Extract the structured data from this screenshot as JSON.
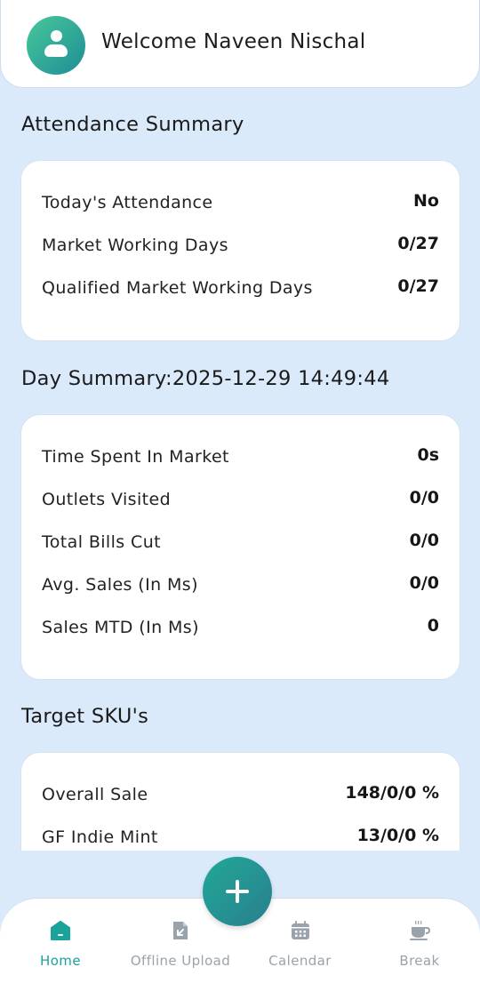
{
  "header": {
    "welcome_text": "Welcome Naveen Nischal"
  },
  "attendance": {
    "title": "Attendance Summary",
    "rows": [
      {
        "label": "Today's Attendance",
        "value": "No"
      },
      {
        "label": "Market Working Days",
        "value": "0/27"
      },
      {
        "label": "Qualified Market Working Days",
        "value": "0/27"
      }
    ]
  },
  "day_summary": {
    "title": "Day Summary:2025-12-29 14:49:44",
    "rows": [
      {
        "label": "Time Spent In Market",
        "value": "0s"
      },
      {
        "label": "Outlets Visited",
        "value": "0/0"
      },
      {
        "label": "Total Bills Cut",
        "value": "0/0"
      },
      {
        "label": "Avg. Sales (In Ms)",
        "value": "0/0"
      },
      {
        "label": "Sales MTD (In Ms)",
        "value": "0"
      }
    ]
  },
  "target_sku": {
    "title": "Target SKU's",
    "rows": [
      {
        "label": "Overall Sale",
        "value": "148/0/0 %"
      },
      {
        "label": "GF Indie Mint",
        "value": "13/0/0 %"
      }
    ]
  },
  "nav": {
    "items": [
      {
        "label": "Home",
        "icon": "home-icon",
        "active": true
      },
      {
        "label": "Offline Upload",
        "icon": "offline-upload-icon",
        "active": false
      },
      {
        "label": "Calendar",
        "icon": "calendar-icon",
        "active": false
      },
      {
        "label": "Break",
        "icon": "coffee-cup-icon",
        "active": false
      }
    ]
  },
  "fab": {
    "icon": "plus-icon"
  },
  "colors": {
    "background": "#dbeafb",
    "accent": "#1aa39a",
    "card": "#ffffff",
    "inactive": "#9aa3ab"
  }
}
